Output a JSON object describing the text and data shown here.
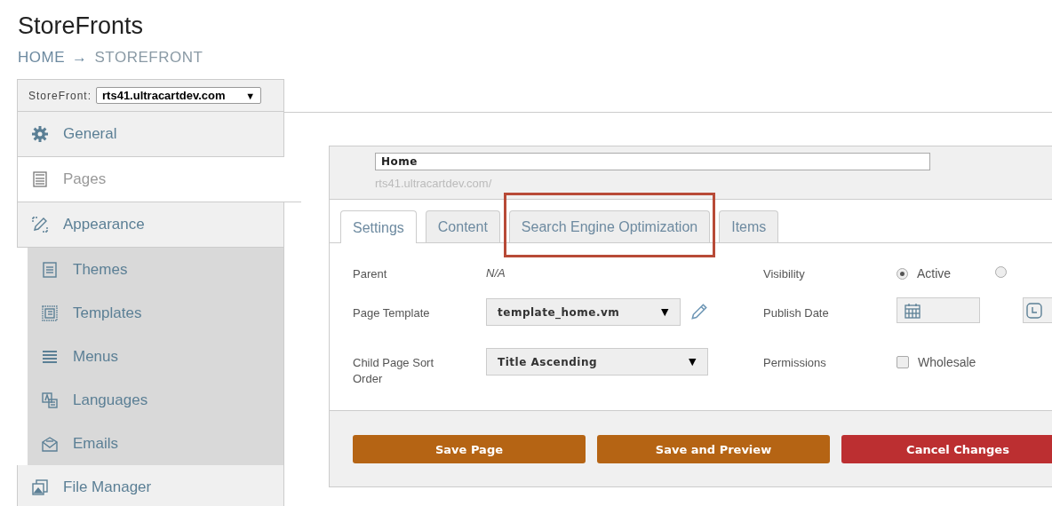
{
  "page_title": "StoreFronts",
  "breadcrumb": {
    "items": [
      "HOME",
      "STOREFRONT"
    ],
    "separator": "→"
  },
  "storefront_select": {
    "label": "StoreFront:",
    "value": "rts41.ultracartdev.com",
    "caret": "▼"
  },
  "sidebar": {
    "items": [
      {
        "label": "General",
        "kind": "gear",
        "selected": false
      },
      {
        "label": "Pages",
        "kind": "page",
        "selected": true
      },
      {
        "label": "Appearance",
        "kind": "pencil",
        "selected": false,
        "children": [
          {
            "label": "Themes",
            "kind": "themes"
          },
          {
            "label": "Templates",
            "kind": "template"
          },
          {
            "label": "Menus",
            "kind": "menu"
          },
          {
            "label": "Languages",
            "kind": "language"
          },
          {
            "label": "Emails",
            "kind": "email"
          }
        ]
      },
      {
        "label": "File Manager",
        "kind": "file",
        "selected": false
      }
    ]
  },
  "page_editor": {
    "name_value": "Home",
    "url": "rts41.ultracartdev.com/",
    "tabs": [
      {
        "label": "Settings",
        "selected": true,
        "highlighted": false
      },
      {
        "label": "Content",
        "selected": false,
        "highlighted": false
      },
      {
        "label": "Search Engine Optimization",
        "selected": false,
        "highlighted": true
      },
      {
        "label": "Items",
        "selected": false,
        "highlighted": false
      }
    ],
    "left_fields": [
      {
        "label": "Parent",
        "kind": "text",
        "value": "N/A"
      },
      {
        "label": "Page Template",
        "kind": "select",
        "value": "template_home.vm",
        "caret": "▼",
        "editable": true
      },
      {
        "label": "Child Page Sort Order",
        "kind": "select",
        "value": "Title Ascending",
        "caret": "▼",
        "editable": false
      }
    ],
    "right_fields": [
      {
        "label": "Visibility",
        "kind": "radio",
        "options": [
          {
            "label": "Active",
            "selected": true
          },
          {
            "selected": false
          }
        ]
      },
      {
        "label": "Publish Date",
        "kind": "datetime"
      },
      {
        "label": "Permissions",
        "kind": "checkbox",
        "options": [
          {
            "label": "Wholesale",
            "checked": false
          }
        ]
      }
    ],
    "buttons": [
      {
        "label": "Save Page",
        "kind": "primary"
      },
      {
        "label": "Save and Preview",
        "kind": "primary"
      },
      {
        "label": "Cancel Changes",
        "kind": "danger"
      }
    ]
  }
}
